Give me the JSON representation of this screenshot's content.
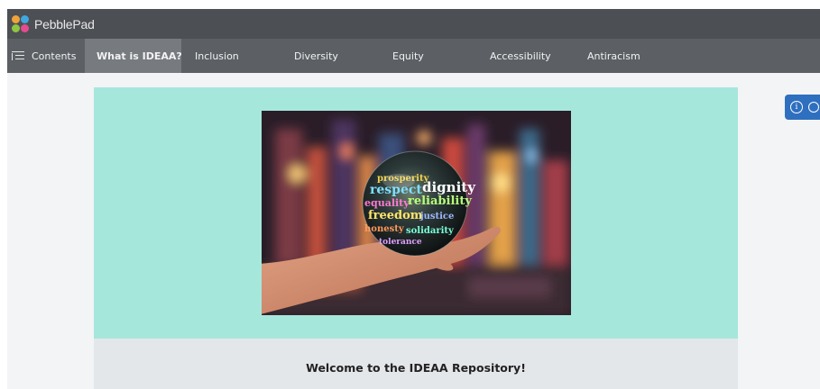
{
  "header": {
    "app_name": "PebblePad"
  },
  "nav": {
    "contents_label": "Contents",
    "items": [
      {
        "label": "What is IDEAA?",
        "active": true
      },
      {
        "label": "Inclusion",
        "active": false
      },
      {
        "label": "Diversity",
        "active": false
      },
      {
        "label": "Equity",
        "active": false
      },
      {
        "label": "Accessibility",
        "active": false
      },
      {
        "label": "Antiracism",
        "active": false
      }
    ]
  },
  "hero": {
    "image_alt": "Hand holding a crystal globe"
  },
  "main": {
    "welcome_text": "Welcome to the IDEAA Repository!"
  },
  "colors": {
    "header_bg": "#4c4f53",
    "nav_bg": "#5c6065",
    "nav_active_bg": "#777b80",
    "hero_bg": "#a6e7dc",
    "info_button": "#2f6fbf"
  },
  "icons": {
    "contents": "list-icon",
    "info": "info-icon",
    "comment": "comment-icon"
  }
}
